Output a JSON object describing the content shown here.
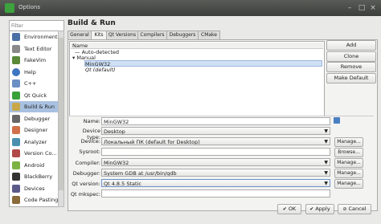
{
  "window": {
    "title": "Options"
  },
  "filter": {
    "placeholder": "Filter"
  },
  "sidebar": {
    "items": [
      {
        "label": "Environment",
        "icon": "environment-icon",
        "color": "#4a6fa5"
      },
      {
        "label": "Text Editor",
        "icon": "text-editor-icon",
        "color": "#8a8a8a"
      },
      {
        "label": "FakeVim",
        "icon": "fakevim-icon",
        "color": "#5a8a3a"
      },
      {
        "label": "Help",
        "icon": "help-icon",
        "color": "#3f74c0"
      },
      {
        "label": "C++",
        "icon": "cpp-icon",
        "color": "#6b8fc4"
      },
      {
        "label": "Qt Quick",
        "icon": "qt-quick-icon",
        "color": "#3aa13a"
      },
      {
        "label": "Build & Run",
        "icon": "build-run-icon",
        "color": "#c9a84a"
      },
      {
        "label": "Debugger",
        "icon": "debugger-icon",
        "color": "#666666"
      },
      {
        "label": "Designer",
        "icon": "designer-icon",
        "color": "#d0704a"
      },
      {
        "label": "Analyzer",
        "icon": "analyzer-icon",
        "color": "#4a8fb0"
      },
      {
        "label": "Version Co...",
        "icon": "version-control-icon",
        "color": "#b04a4a"
      },
      {
        "label": "Android",
        "icon": "android-icon",
        "color": "#7cb342"
      },
      {
        "label": "BlackBerry",
        "icon": "blackberry-icon",
        "color": "#333333"
      },
      {
        "label": "Devices",
        "icon": "devices-icon",
        "color": "#5a5a8a"
      },
      {
        "label": "Code Pasting",
        "icon": "code-pasting-icon",
        "color": "#8a6a3a"
      }
    ]
  },
  "page": {
    "title": "Build & Run",
    "tabs": [
      "General",
      "Kits",
      "Qt Versions",
      "Compilers",
      "Debuggers",
      "CMake"
    ]
  },
  "tree": {
    "header": "Name",
    "auto_detected": "Auto-detected",
    "manual": "Manual",
    "kit_selected": "MinGW32",
    "kit_default": "Qt (default)"
  },
  "side_buttons": {
    "add": "Add",
    "clone": "Clone",
    "remove": "Remove",
    "make_default": "Make Default"
  },
  "form": {
    "name_label": "Name:",
    "name_value": "MinGW32",
    "device_type_label": "Device type:",
    "device_type_value": "Desktop",
    "device_label": "Device:",
    "device_value": "Локальный ПК (default for Desktop)",
    "sysroot_label": "Sysroot:",
    "sysroot_value": "",
    "compiler_label": "Compiler:",
    "compiler_value": "MinGW32",
    "debugger_label": "Debugger:",
    "debugger_value": "System GDB at /usr/bin/gdb",
    "qt_version_label": "Qt version:",
    "qt_version_value": "Qt 4.8.5 Static",
    "qt_mkspec_label": "Qt mkspec:",
    "qt_mkspec_value": "",
    "manage": "Manage...",
    "browse": "Browse..."
  },
  "bottom_buttons": {
    "ok": "OK",
    "apply": "Apply",
    "cancel": "Cancel"
  }
}
